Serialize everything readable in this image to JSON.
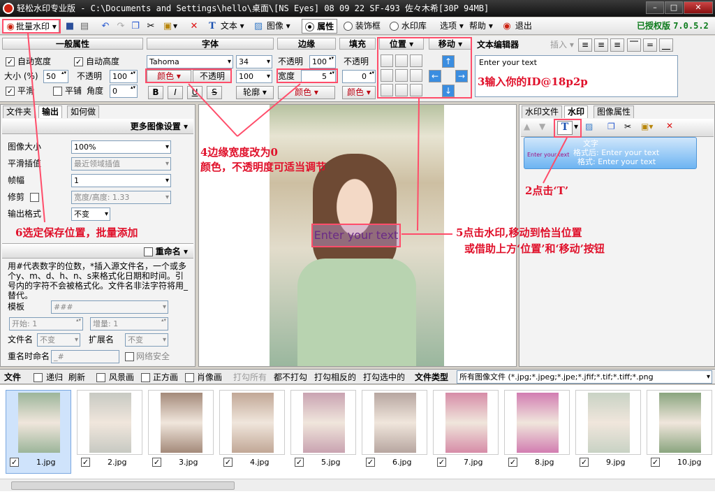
{
  "window": {
    "title": "轻松水印专业版 - C:\\Documents and Settings\\hello\\桌面\\[NS Eyes] 08 09 22 SF-493 佐々木希[30P 94MB]",
    "min": "–",
    "max": "□",
    "close": "✕"
  },
  "toolbar": {
    "batch": "批量水印",
    "text": "文本",
    "image": "图像",
    "props": "属性",
    "frame": "装饰框",
    "library": "水印库",
    "options": "选项",
    "help": "帮助",
    "exit": "退出",
    "licensed": "已授权版",
    "version": "7.0.5.2"
  },
  "props": {
    "general": "一般属性",
    "font": "字体",
    "border": "边缘",
    "fill": "填充",
    "position": "位置",
    "move": "移动",
    "editor": "文本编辑器",
    "insert": "插入",
    "auto_width": "自动宽度",
    "auto_height": "自动高度",
    "size_label": "大小 (%)",
    "size_val": "50",
    "opacity_label": "不透明",
    "opacity_val": "100",
    "smooth": "平滑",
    "tile": "平铺",
    "angle_label": "角度",
    "angle_val": "0",
    "font_name": "Tahoma",
    "font_size": "34",
    "color": "颜色",
    "font_opacity": "不透明",
    "font_opacity_val": "100",
    "bold": "B",
    "italic": "I",
    "underline": "U",
    "strike": "S",
    "outline": "轮廓",
    "border_opacity": "不透明",
    "border_opacity_val": "100",
    "border_width_label": "宽度",
    "border_width_val": "5",
    "border_color": "颜色",
    "fill_opacity": "不透明",
    "fill_val": "0",
    "fill_color": "颜色",
    "editor_text": "Enter your text"
  },
  "left": {
    "tabs": [
      "文件夹",
      "输出",
      "如何做"
    ],
    "more_settings": "更多图像设置",
    "image_size": "图像大小",
    "image_size_val": "100%",
    "smooth_interp": "平滑插值",
    "smooth_interp_val": "最近领域插值",
    "frames": "帧幅",
    "frames_val": "1",
    "crop": "修剪",
    "crop_val": "宽度/高度: 1.33",
    "format": "输出格式",
    "format_val": "不变",
    "rename": "重命名",
    "rename_desc": "用#代表数字的位数，*插入源文件名，一个或多个y、m、d、h、n、s来格式化日期和时间。引号内的字符不会被格式化。文件名非法字符将用_替代。",
    "template": "模板",
    "template_val": "###",
    "start": "开始: 1",
    "step": "增量: 1",
    "filename": "文件名",
    "filename_val": "不变",
    "ext": "扩展名",
    "ext_val": "不变",
    "rename_on": "重名时命名",
    "rename_on_val": "_#",
    "net_safe": "网络安全"
  },
  "right": {
    "tabs": [
      "水印文件",
      "水印",
      "图像属性"
    ],
    "item_line1": "文字",
    "item_line2": "格式后: Enter your text",
    "item_line3": "格式: Enter your text",
    "item_thumb": "Enter your text"
  },
  "canvas": {
    "watermark": "Enter your text"
  },
  "annotations": {
    "a1": "3输入你的ID@18p2p",
    "a2": "2点击‘T’",
    "a3": "4边缘宽度改为0",
    "a3b": "颜色，不透明度可适当调节",
    "a4": "5点击水印,移动到恰当位置",
    "a4b": "或借助上方‘位置’和‘移动’按钮",
    "a5": "6选定保存位置，批量添加"
  },
  "filebar": {
    "file": "文件",
    "recursive": "递归",
    "refresh": "刷新",
    "landscape": "风景画",
    "square": "正方画",
    "portrait": "肖像画",
    "check_all": "打勾所有",
    "check_none": "都不打勾",
    "check_invert": "打勾相反的",
    "check_selected": "打勾选中的",
    "file_type": "文件类型",
    "types": "所有图像文件  (*.jpg;*.jpeg;*.jpe;*.jfif;*.tif;*.tiff;*.png"
  },
  "files": [
    "1.jpg",
    "2.jpg",
    "3.jpg",
    "4.jpg",
    "5.jpg",
    "6.jpg",
    "7.jpg",
    "8.jpg",
    "9.jpg",
    "10.jpg"
  ],
  "colors": {
    "accent": "#0a7a1a",
    "annotation": "#e0102a"
  }
}
